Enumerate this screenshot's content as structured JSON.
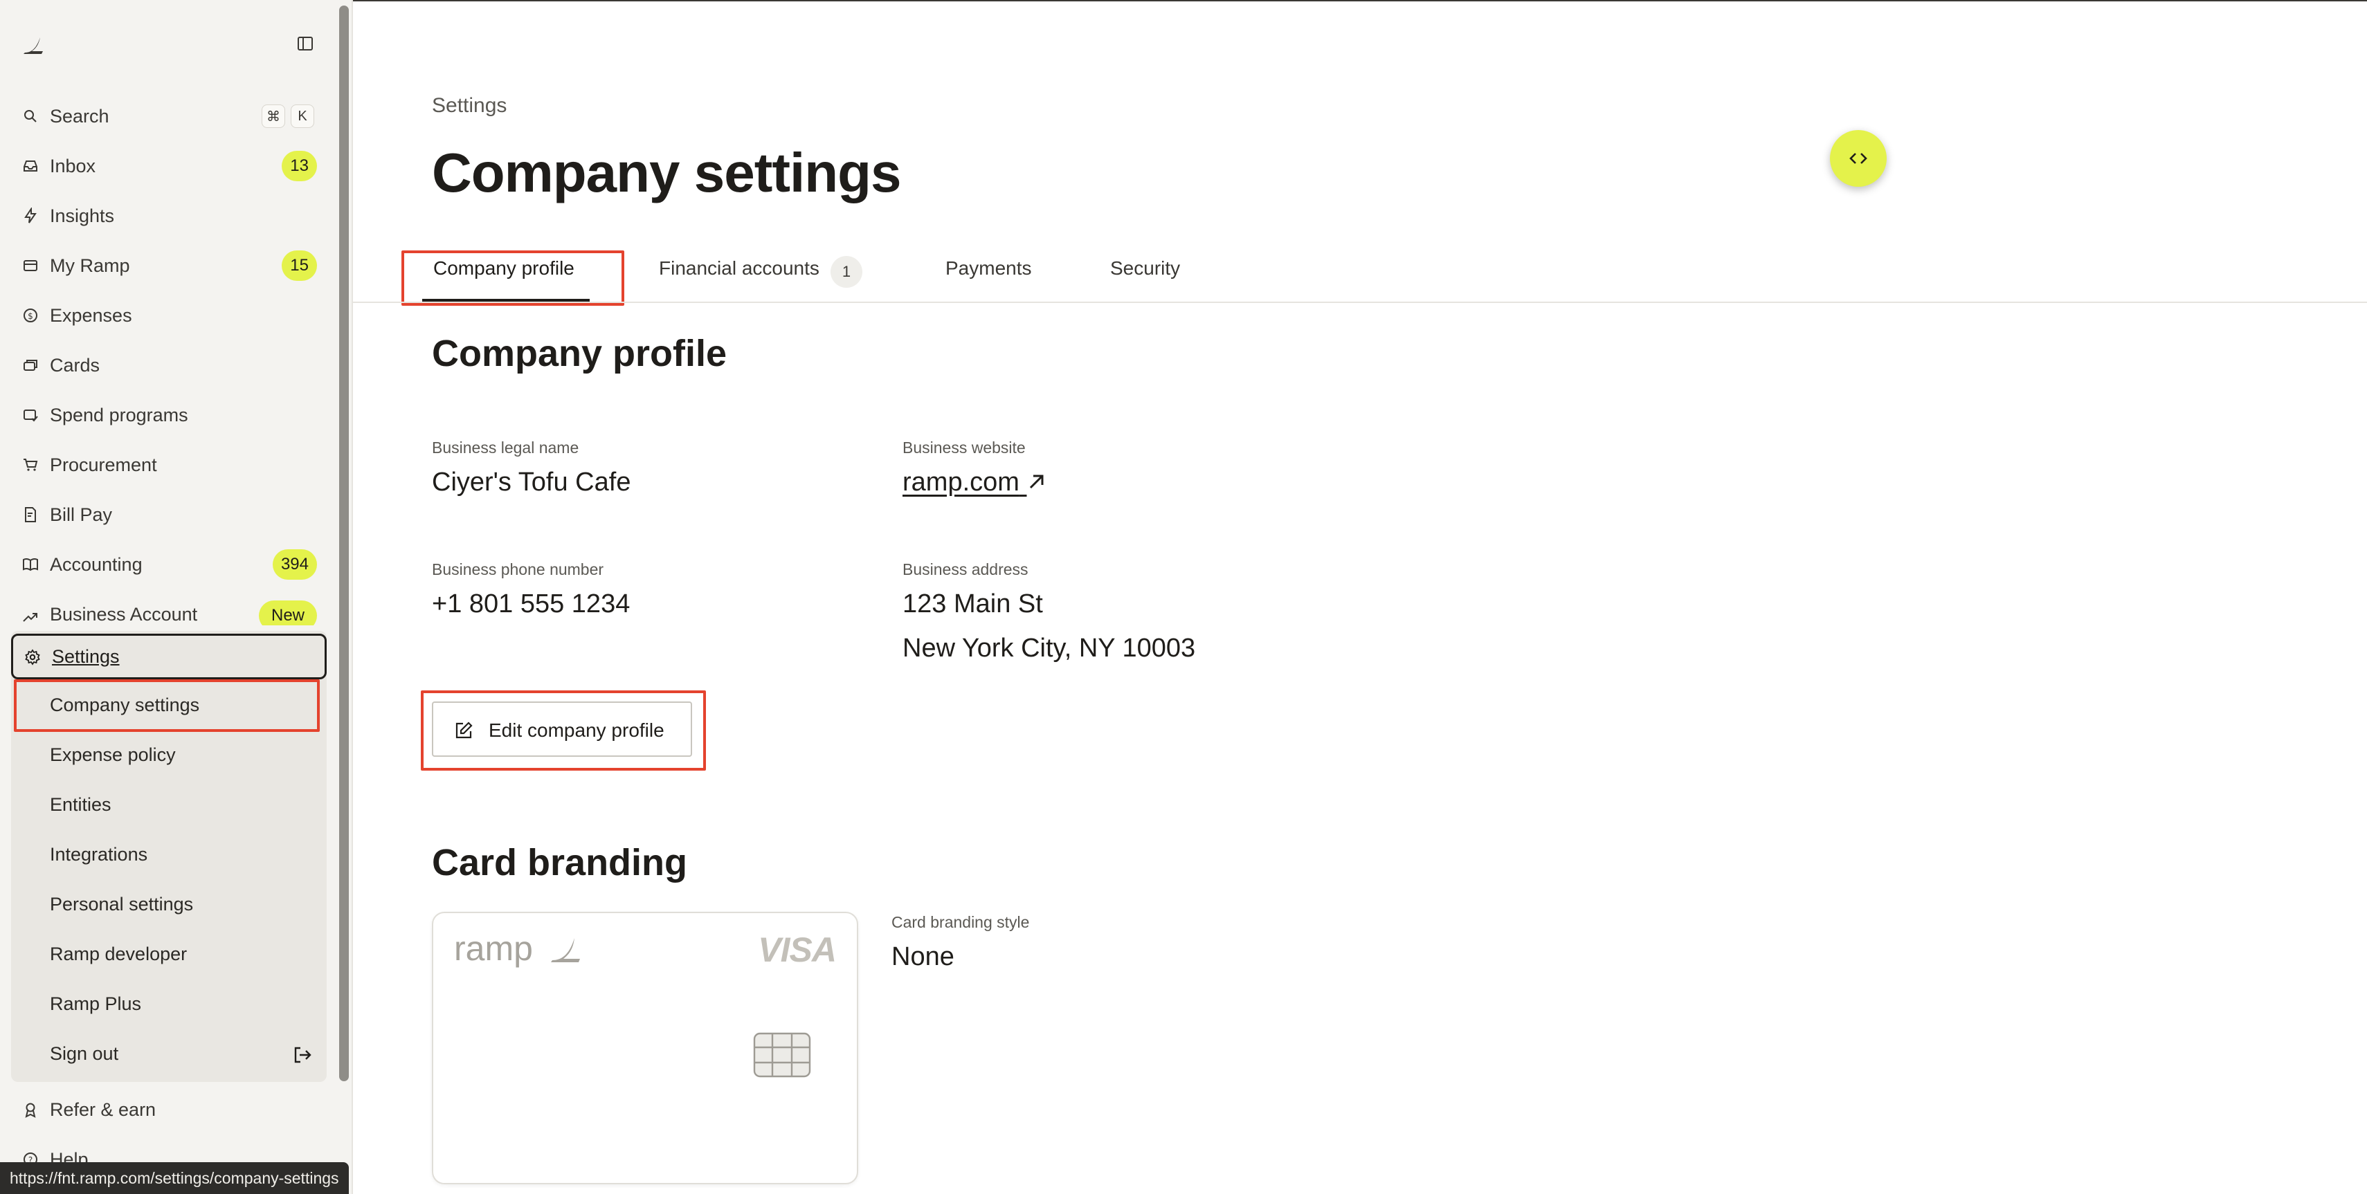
{
  "sidebar": {
    "nav": [
      {
        "label": "Search",
        "icon": "search-icon",
        "shortcut": [
          "⌘",
          "K"
        ]
      },
      {
        "label": "Inbox",
        "icon": "inbox-icon",
        "badge": "13"
      },
      {
        "label": "Insights",
        "icon": "lightning-icon"
      },
      {
        "label": "My Ramp",
        "icon": "card-outline-icon",
        "badge": "15"
      },
      {
        "label": "Expenses",
        "icon": "dollar-circle-icon"
      },
      {
        "label": "Cards",
        "icon": "cards-icon"
      },
      {
        "label": "Spend programs",
        "icon": "spend-programs-icon"
      },
      {
        "label": "Procurement",
        "icon": "cart-icon"
      },
      {
        "label": "Bill Pay",
        "icon": "bill-icon"
      },
      {
        "label": "Accounting",
        "icon": "book-icon",
        "badge": "394"
      },
      {
        "label": "Business Account",
        "icon": "trend-icon",
        "badge": "New"
      }
    ],
    "settings": {
      "label": "Settings",
      "items": [
        "Company settings",
        "Expense policy",
        "Entities",
        "Integrations",
        "Personal settings",
        "Ramp developer",
        "Ramp Plus",
        "Sign out"
      ]
    },
    "footer": [
      {
        "label": "Refer & earn",
        "icon": "award-icon"
      },
      {
        "label": "Help",
        "icon": "help-icon"
      }
    ]
  },
  "status_url": "https://fnt.ramp.com/settings/company-settings",
  "header": {
    "breadcrumb": "Settings",
    "title": "Company settings"
  },
  "tabs": [
    {
      "label": "Company profile",
      "active": true
    },
    {
      "label": "Financial accounts",
      "count": "1"
    },
    {
      "label": "Payments"
    },
    {
      "label": "Security"
    }
  ],
  "profile": {
    "title": "Company profile",
    "legal_name_label": "Business legal name",
    "legal_name": "Ciyer's Tofu Cafe",
    "website_label": "Business website",
    "website": "ramp.com",
    "phone_label": "Business phone number",
    "phone": "+1 801 555 1234",
    "address_label": "Business address",
    "address_line1": "123 Main St",
    "address_line2": "New York City, NY 10003",
    "edit_button": "Edit company profile"
  },
  "branding": {
    "title": "Card branding",
    "card_brand": "ramp",
    "card_network": "VISA",
    "style_label": "Card branding style",
    "style_value": "None"
  },
  "colors": {
    "accent": "#e4f24b",
    "highlight": "#e4432e",
    "sidebar_bg": "#f4f3f0"
  }
}
